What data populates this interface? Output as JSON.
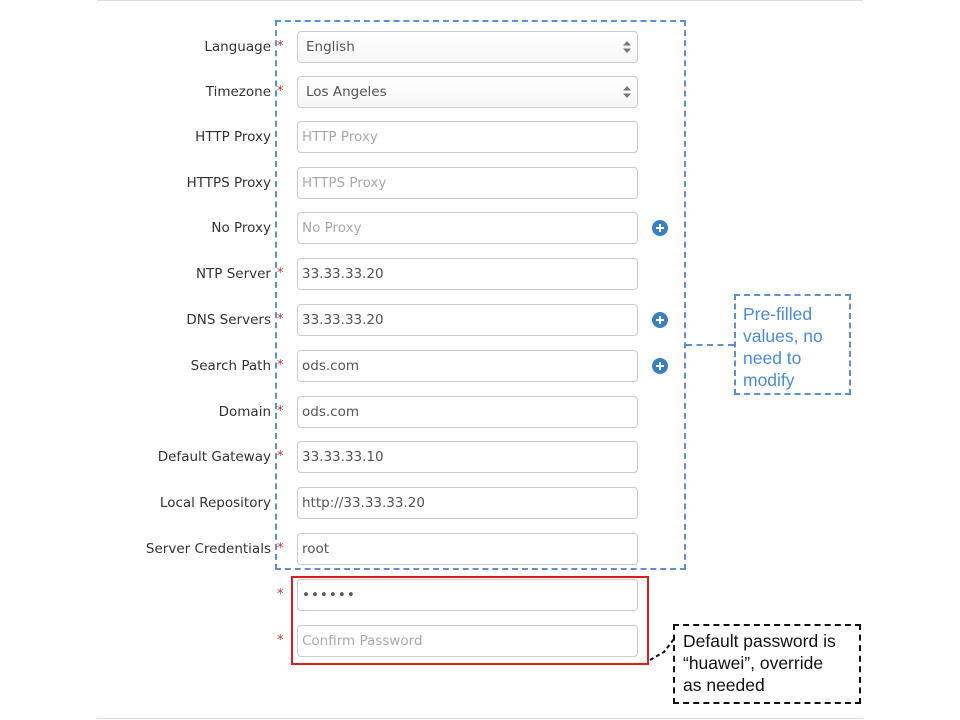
{
  "form": {
    "language": {
      "label": "Language",
      "required": "*",
      "value": "English"
    },
    "timezone": {
      "label": "Timezone",
      "required": "*",
      "value": "Los Angeles"
    },
    "http_proxy": {
      "label": "HTTP Proxy",
      "placeholder": "HTTP Proxy",
      "value": ""
    },
    "https_proxy": {
      "label": "HTTPS Proxy",
      "placeholder": "HTTPS Proxy",
      "value": ""
    },
    "no_proxy": {
      "label": "No Proxy",
      "placeholder": "No Proxy",
      "value": ""
    },
    "ntp_server": {
      "label": "NTP Server",
      "required": "*",
      "value": "33.33.33.20"
    },
    "dns_servers": {
      "label": "DNS Servers",
      "required": "*",
      "value": "33.33.33.20"
    },
    "search_path": {
      "label": "Search Path",
      "required": "*",
      "value": "ods.com"
    },
    "domain": {
      "label": "Domain",
      "required": "*",
      "value": "ods.com"
    },
    "default_gateway": {
      "label": "Default Gateway",
      "required": "*",
      "value": "33.33.33.10"
    },
    "local_repository": {
      "label": "Local Repository",
      "value": "http://33.33.33.20"
    },
    "server_credentials": {
      "label": "Server Credentials",
      "required": "*",
      "value": "root"
    },
    "password": {
      "required": "*",
      "value": "••••••"
    },
    "confirm_password": {
      "required": "*",
      "placeholder": "Confirm Password",
      "value": ""
    }
  },
  "annotations": {
    "prefilled_note": [
      "Pre-filled",
      "values, no",
      "need to",
      "modify"
    ],
    "password_note": [
      "Default password is",
      "“huawei”, override",
      "as needed"
    ]
  },
  "colors": {
    "required": "#c9302c",
    "add_icon": "#3a7fc1",
    "prefilled_box": "#5b8fd6",
    "password_box": "#e01b1b",
    "password_note_border": "#111111"
  },
  "icons": {
    "add": "plus-circle-icon",
    "select": "select-arrows-icon"
  }
}
